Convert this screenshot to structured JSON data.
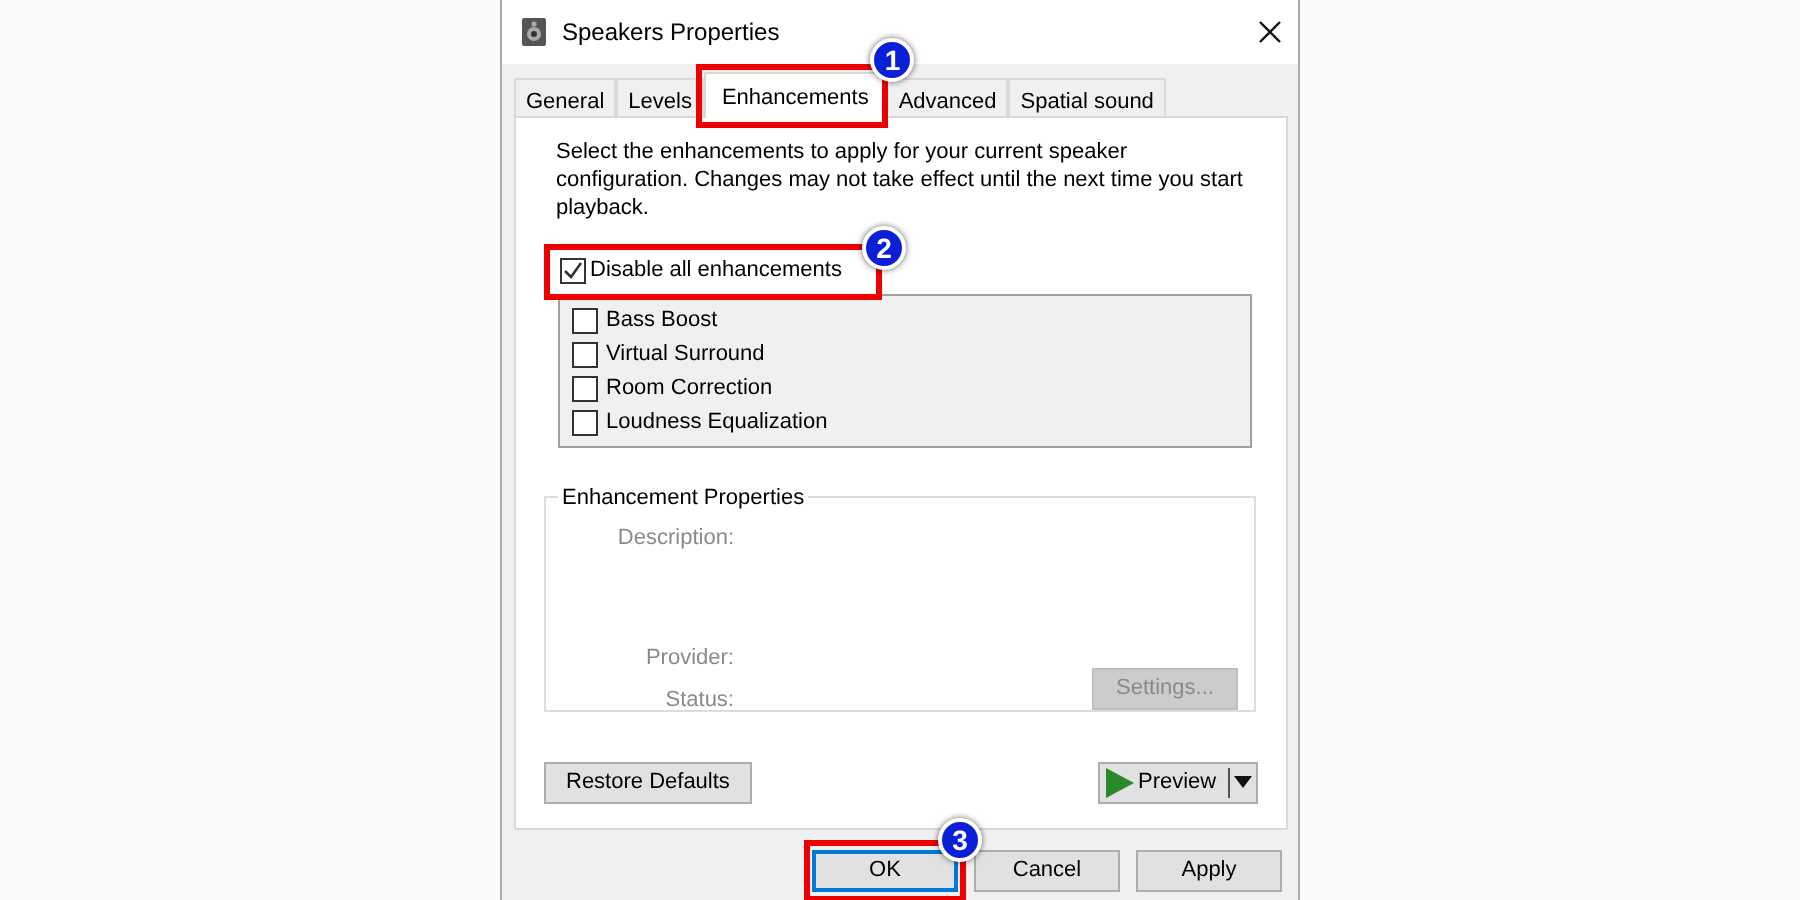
{
  "window": {
    "title": "Speakers Properties"
  },
  "tabs": [
    {
      "label": "General",
      "selected": false
    },
    {
      "label": "Levels",
      "selected": false
    },
    {
      "label": "Enhancements",
      "selected": true,
      "callout": "1"
    },
    {
      "label": "Advanced",
      "selected": false
    },
    {
      "label": "Spatial sound",
      "selected": false
    }
  ],
  "intro": "Select the enhancements to apply for your current speaker configuration. Changes may not take effect until the next time you start playback.",
  "disable_all": {
    "label": "Disable all enhancements",
    "checked": true,
    "callout": "2"
  },
  "enhancements": [
    {
      "label": "Bass Boost",
      "checked": false
    },
    {
      "label": "Virtual Surround",
      "checked": false
    },
    {
      "label": "Room Correction",
      "checked": false
    },
    {
      "label": "Loudness Equalization",
      "checked": false
    }
  ],
  "enhancement_properties": {
    "title": "Enhancement Properties",
    "fields": [
      {
        "label": "Description:"
      },
      {
        "label": "Provider:"
      },
      {
        "label": "Status:"
      }
    ],
    "settings_button": {
      "label": "Settings...",
      "disabled": true
    }
  },
  "restore_button": "Restore Defaults",
  "preview_button": "Preview",
  "buttons": [
    {
      "label": "OK",
      "default": true,
      "callout": "3"
    },
    {
      "label": "Cancel",
      "default": false
    },
    {
      "label": "Apply",
      "default": false
    }
  ]
}
